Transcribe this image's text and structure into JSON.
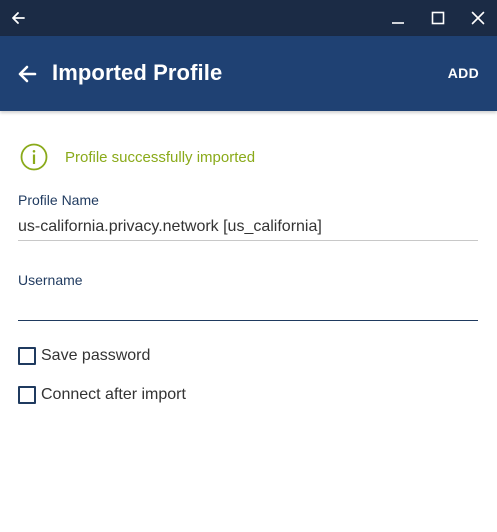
{
  "colors": {
    "titlebar_bg": "#1b2b45",
    "appbar_bg": "#1f4173",
    "success_green": "#8aaa1a",
    "accent_navy": "#1f3a5f"
  },
  "window_controls": {
    "back_icon": "arrow-left-icon",
    "minimize_icon": "minimize-icon",
    "maximize_icon": "maximize-icon",
    "close_icon": "close-icon"
  },
  "appbar": {
    "back_icon": "arrow-left-icon",
    "title": "Imported Profile",
    "action_label": "ADD"
  },
  "status": {
    "icon": "info-circle-icon",
    "message": "Profile successfully imported"
  },
  "form": {
    "profile_name": {
      "label": "Profile Name",
      "value": "us-california.privacy.network [us_california]"
    },
    "username": {
      "label": "Username",
      "value": ""
    },
    "save_password": {
      "label": "Save password",
      "checked": false
    },
    "connect_after_import": {
      "label": "Connect after import",
      "checked": false
    }
  }
}
